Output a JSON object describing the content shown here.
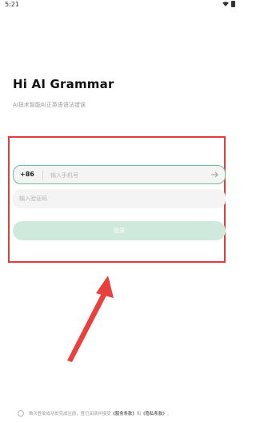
{
  "status_bar": {
    "time": "5:21"
  },
  "app": {
    "title": "Hi AI Grammar",
    "subtitle": "AI技术智能纠正英语语法错误"
  },
  "login_form": {
    "country_code": "+86",
    "phone_placeholder": "输入手机号",
    "code_placeholder": "输入验证码",
    "login_button_label": "登录"
  },
  "agreement": {
    "text_prefix": "首次登录成功即完成注册，登已阅读并接受",
    "terms_link": "《服务条款》",
    "and_text": "和",
    "privacy_link": "《隐私条款》",
    "suffix": "。"
  },
  "colors": {
    "field_border": "#6fbf9c",
    "login_button_bg": "#cfeadd",
    "highlight": "#e23c3c"
  },
  "icons": [
    "wifi-icon",
    "battery-icon",
    "arrow-right-icon",
    "radio-unchecked-icon",
    "red-annotation-arrow"
  ]
}
